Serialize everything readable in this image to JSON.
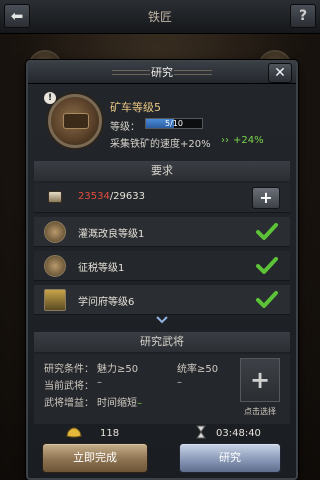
{
  "background": {
    "title": "铁匠",
    "help_label": "?"
  },
  "modal": {
    "title": "研究",
    "close_label": "✕"
  },
  "tech": {
    "info_badge": "!",
    "name": "矿车等级5",
    "level_label": "等级：",
    "level_text": "5/10",
    "level_progress": 0.5,
    "effect": "采集铁矿的速度+20%",
    "effect_arrow": "››",
    "effect_bonus": "+24%"
  },
  "requirements": {
    "header": "要求",
    "resource_current": "23534",
    "resource_total": "/29633",
    "add_label": "+",
    "items": [
      {
        "label": "灌溉改良等级1"
      },
      {
        "label": "征税等级1"
      },
      {
        "label": "学问府等级6"
      }
    ]
  },
  "general": {
    "header": "研究武将",
    "condition_label": "研究条件：",
    "condition_charm": "魅力≥50",
    "condition_command": "统率≥50",
    "current_label": "当前武将：",
    "current_value_1": "–",
    "current_value_2": "–",
    "bonus_label": "武将增益：",
    "bonus_value": "时间缩短",
    "bonus_suffix": "–",
    "select_plus": "+",
    "select_label": "点击选择"
  },
  "footer": {
    "gold_value": "118",
    "time_value": "03:48:40",
    "finish_label": "立即完成",
    "research_label": "研究"
  },
  "colors": {
    "accent_gold": "#e9c682",
    "insufficient_red": "#e24c3e",
    "bonus_green": "#7bd44a",
    "check_green": "#5cc238"
  }
}
